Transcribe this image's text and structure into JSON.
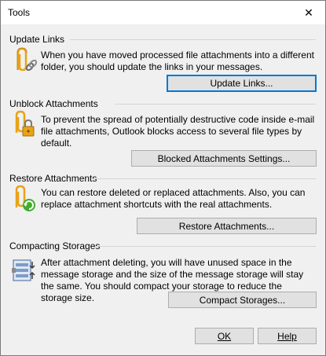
{
  "window": {
    "title": "Tools",
    "close_glyph": "✕"
  },
  "sections": [
    {
      "heading": "Update Links",
      "text": "When you have moved processed file attachments into a different folder, you should update the links in your messages.",
      "button": "Update Links...",
      "icon": "paperclip-links-icon"
    },
    {
      "heading": "Unblock Attachments",
      "text": "To prevent the spread of potentially destructive code inside e-mail file attachments, Outlook blocks access to several file types by default.",
      "button": "Blocked Attachments Settings...",
      "icon": "paperclip-lock-icon"
    },
    {
      "heading": "Restore Attachments",
      "text": "You can restore deleted or replaced attachments. Also, you can replace attachment shortcuts with the real attachments.",
      "button": "Restore Attachments...",
      "icon": "paperclip-restore-icon"
    },
    {
      "heading": "Compacting Storages",
      "text": "After attachment deleting, you will have unused space in the message storage and the size of the message storage will stay the same. You should compact your storage to reduce the storage size.",
      "button": "Compact Storages...",
      "icon": "compress-storage-icon"
    }
  ],
  "footer": {
    "ok_label": "OK",
    "help_label": "Help"
  },
  "colors": {
    "accent": "#0078d7",
    "clip": "#e8a317",
    "arrow": "#3fae2a"
  }
}
